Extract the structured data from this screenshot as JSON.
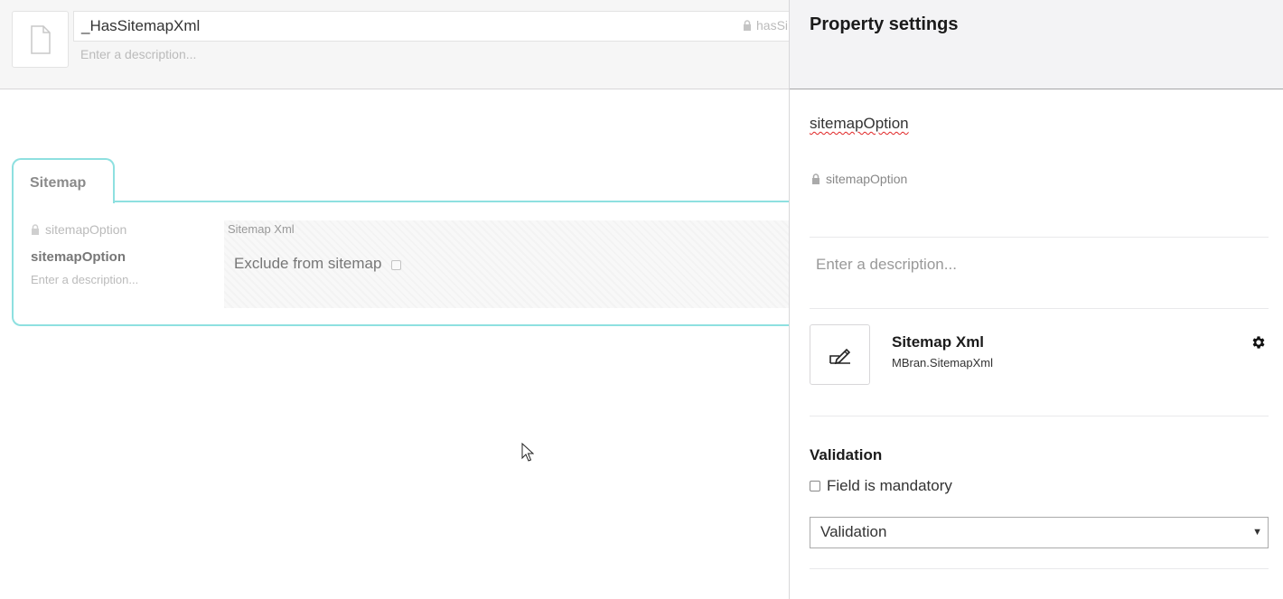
{
  "header": {
    "name_value": "_HasSitemapXml",
    "alias": "hasSi",
    "description_placeholder": "Enter a description..."
  },
  "group": {
    "tab_label": "Sitemap",
    "property": {
      "alias": "sitemapOption",
      "name": "sitemapOption",
      "description_placeholder": "Enter a description...",
      "editor_name": "Sitemap Xml",
      "exclude_label": "Exclude from sitemap"
    }
  },
  "panel": {
    "title": "Property settings",
    "property_name": "sitemapOption",
    "property_alias": "sitemapOption",
    "description_placeholder": "Enter a description...",
    "editor": {
      "title": "Sitemap Xml",
      "alias": "MBran.SitemapXml",
      "icon": "edit-icon"
    },
    "validation": {
      "title": "Validation",
      "mandatory_label": "Field is mandatory",
      "mandatory_checked": false,
      "select_value": "Validation"
    }
  },
  "colors": {
    "tab_border": "#8ee0e0",
    "panel_header": "#f3f3f5",
    "spellcheck": "#e02424"
  }
}
